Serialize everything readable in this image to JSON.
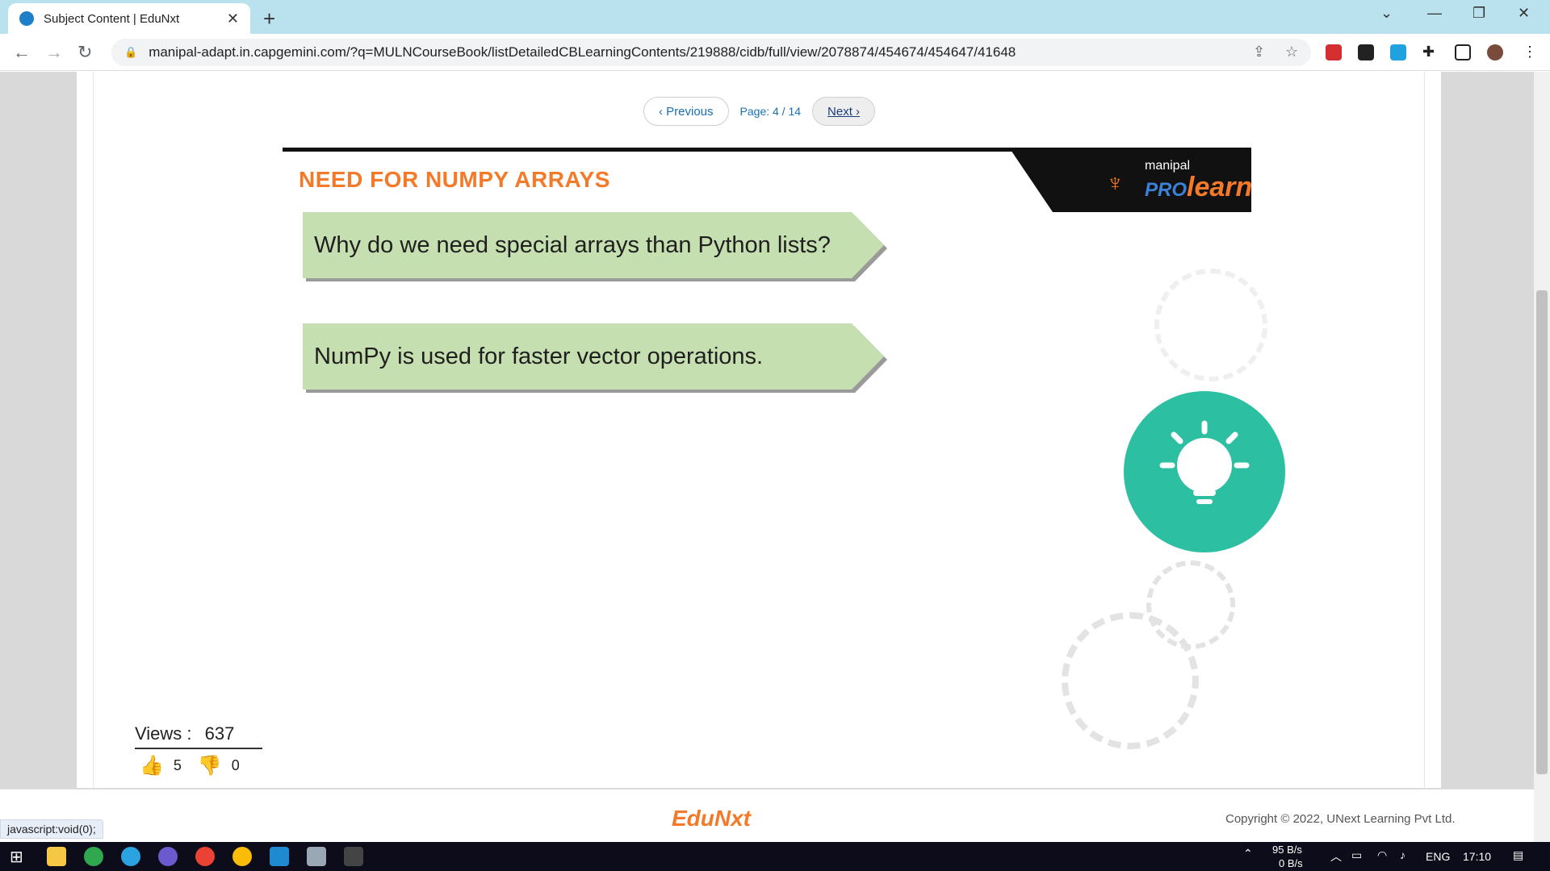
{
  "browser": {
    "tab_title": "Subject Content | EduNxt",
    "url": "manipal-adapt.in.capgemini.com/?q=MULNCourseBook/listDetailedCBLearningContents/219888/cidb/full/view/2078874/454674/454647/41648"
  },
  "pager": {
    "previous_label": "‹ Previous",
    "page_label": "Page: 4 / 14",
    "next_label": "Next ›"
  },
  "slide": {
    "title": "NEED FOR NUMPY ARRAYS",
    "logo_small": "manipal",
    "logo_pro": "PRO",
    "logo_learn": "learn",
    "box1": "Why do we need special arrays than Python lists?",
    "box2": "NumPy is used for faster vector operations."
  },
  "stats": {
    "views_label": "Views :",
    "views_count": "637",
    "likes": "5",
    "dislikes": "0"
  },
  "footer": {
    "logo": "EduNxt",
    "copyright": "Copyright © 2022, UNext Learning Pvt Ltd."
  },
  "statusbar": "javascript:void(0);",
  "taskbar": {
    "net_up": "95 B/s",
    "net_down": "0 B/s",
    "lang": "ENG",
    "time": "17:10"
  },
  "colors": {
    "accent_orange": "#f47a2a",
    "arrow_green": "#c5dfb0",
    "bulb_teal": "#2cbfa1"
  }
}
